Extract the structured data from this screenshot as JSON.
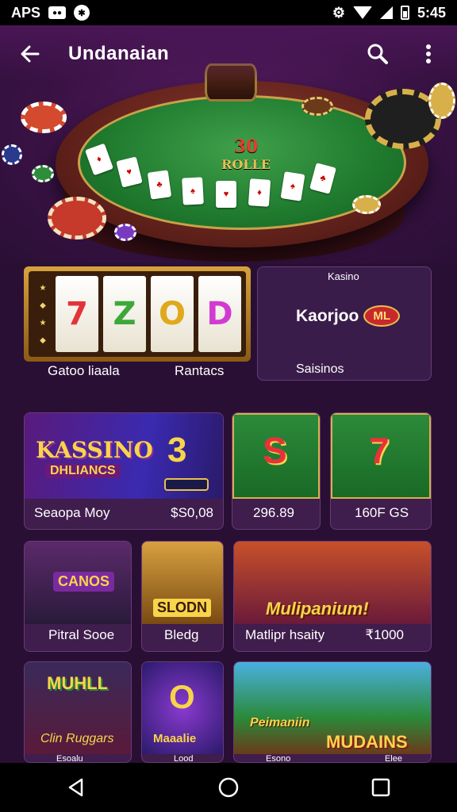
{
  "status_bar": {
    "left_text": "APS",
    "time": "5:45",
    "icons": [
      "notification-box-icon",
      "shield-icon",
      "settings-icon",
      "wifi-icon",
      "signal-icon",
      "battery-icon"
    ]
  },
  "app_bar": {
    "title": "Undanaian",
    "back_icon": "arrow-left-icon",
    "search_icon": "search-icon",
    "more_icon": "more-vert-icon"
  },
  "hero": {
    "felt_line1": "30",
    "felt_line2": "ROLLE"
  },
  "featured": {
    "slot_tile": {
      "reels": [
        "7",
        "Z",
        "O",
        "D"
      ],
      "reel_colors": [
        "#e2323a",
        "#3ca83a",
        "#e0a81c",
        "#d23ad2"
      ],
      "label_left": "Gatoo liaala",
      "label_right": "Rantacs"
    },
    "kasino_tile": {
      "top_label": "Kasino",
      "logo_text": "Kaorjoo",
      "badge_text": "ML",
      "bottom_label": "Saisinos"
    }
  },
  "row1": [
    {
      "art_title": "KASSINO",
      "art_subtitle": "DHLIANCS",
      "art_number": "3",
      "label_left": "Seaopa Moy",
      "label_right": "$S0,08"
    },
    {
      "art_symbol": "S",
      "label": "296.89"
    },
    {
      "art_symbol": "7",
      "label": "160F GS"
    }
  ],
  "row2": [
    {
      "art_text": "CANOS",
      "label": "Pitral Sooe"
    },
    {
      "art_text": "SLODN",
      "label": "Bledg"
    },
    {
      "art_text": "Mulipanium!",
      "label_left": "Matlipr hsaity",
      "label_right": "₹1000"
    }
  ],
  "row3": [
    {
      "art_title": "MUHLL",
      "art_sub": "Clin Ruggars",
      "label": "Esoalu"
    },
    {
      "art_text": "O",
      "art_sub": "Maaalie",
      "label": "Lood"
    },
    {
      "art_title": "Peimaniin",
      "art_sub": "MUDAINS",
      "label_left": "Esono",
      "label_right": "Elee"
    }
  ],
  "nav": {
    "back": "nav-back-icon",
    "home": "nav-home-icon",
    "recents": "nav-recents-icon"
  }
}
